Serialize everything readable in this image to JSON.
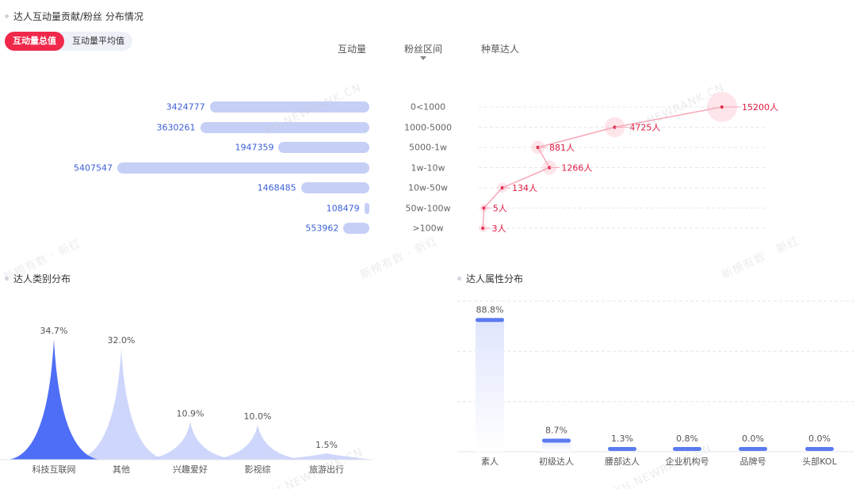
{
  "header": {
    "title": "达人互动量贡献/粉丝 分布情况"
  },
  "tabs": [
    {
      "label": "互动量总值",
      "active": true
    },
    {
      "label": "互动量平均值",
      "active": false
    }
  ],
  "columns": {
    "interaction": "互动量",
    "fans_range": "粉丝区间",
    "kol": "种草达人"
  },
  "interaction_distribution": {
    "rows": [
      {
        "range": "0<1000",
        "interaction": 3424777,
        "interaction_label": "3424777",
        "kol_count": 15200,
        "kol_label": "15200人"
      },
      {
        "range": "1000-5000",
        "interaction": 3630261,
        "interaction_label": "3630261",
        "kol_count": 4725,
        "kol_label": "4725人"
      },
      {
        "range": "5000-1w",
        "interaction": 1947359,
        "interaction_label": "1947359",
        "kol_count": 881,
        "kol_label": "881人"
      },
      {
        "range": "1w-10w",
        "interaction": 5407547,
        "interaction_label": "5407547",
        "kol_count": 1266,
        "kol_label": "1266人"
      },
      {
        "range": "10w-50w",
        "interaction": 1468485,
        "interaction_label": "1468485",
        "kol_count": 134,
        "kol_label": "134人"
      },
      {
        "range": "50w-100w",
        "interaction": 108479,
        "interaction_label": "108479",
        "kol_count": 5,
        "kol_label": "5人"
      },
      {
        "range": ">100w",
        "interaction": 553962,
        "interaction_label": "553962",
        "kol_count": 3,
        "kol_label": "3人"
      }
    ]
  },
  "category_section": {
    "title": "达人类别分布"
  },
  "attribute_section": {
    "title": "达人属性分布"
  },
  "chart_data": [
    {
      "type": "area",
      "categories": [
        "科技互联网",
        "其他",
        "兴趣爱好",
        "影视综",
        "旅游出行"
      ],
      "values": [
        34.7,
        32.0,
        10.9,
        10.0,
        1.5
      ],
      "labels": [
        "34.7%",
        "32.0%",
        "10.9%",
        "10.0%",
        "1.5%"
      ],
      "colors": {
        "highlight": "#4f6ef7",
        "normal": "#c5cffa"
      }
    },
    {
      "type": "bar",
      "categories": [
        "素人",
        "初级达人",
        "腰部达人",
        "企业机构号",
        "品牌号",
        "头部KOL"
      ],
      "values": [
        88.8,
        8.7,
        1.3,
        0.8,
        0.0,
        0.0
      ],
      "labels": [
        "88.8%",
        "8.7%",
        "1.3%",
        "0.8%",
        "0.0%",
        "0.0%"
      ],
      "grid": true,
      "colors": {
        "bar": "#5b7bf0",
        "fill_top": "#dfe5fd"
      }
    }
  ],
  "colors": {
    "accent": "#f0294b",
    "bar": "#c6cff6",
    "value_text": "#3b5fd6",
    "kol_line": "#f7a8b8",
    "kol_dot": "#e0193f"
  },
  "watermarks": [
    "XH.NEWRANK.CN",
    "新榜有数 · 新红"
  ]
}
